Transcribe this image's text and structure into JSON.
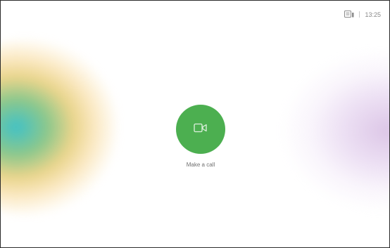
{
  "status_bar": {
    "time": "13:25",
    "device_icon": "touch-panel-icon"
  },
  "call_button": {
    "icon": "video-camera-icon",
    "label": "Make a call",
    "color": "#4caf50"
  },
  "background": {
    "left_gradient_colors": [
      "#36bec4",
      "#e2c664",
      "#f5cd78"
    ],
    "right_gradient_color": "#d6bce2"
  }
}
